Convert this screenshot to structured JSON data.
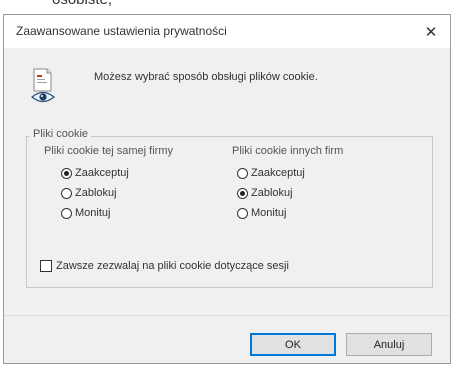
{
  "backdrop": {
    "text": "osobiste;"
  },
  "dialog": {
    "title": "Zaawansowane ustawienia prywatności",
    "close_glyph": "✕",
    "info_text": "Możesz wybrać sposób obsługi plików cookie.",
    "group": {
      "label": "Pliki cookie",
      "first_party": {
        "heading": "Pliki cookie tej samej firmy",
        "options": [
          "Zaakceptuj",
          "Zablokuj",
          "Monituj"
        ],
        "selected": "Zaakceptuj"
      },
      "third_party": {
        "heading": "Pliki cookie innych firm",
        "options": [
          "Zaakceptuj",
          "Zablokuj",
          "Monituj"
        ],
        "selected": "Zablokuj"
      },
      "session_checkbox": {
        "label": "Zawsze zezwalaj na pliki cookie dotyczące sesji",
        "checked": false
      }
    },
    "buttons": {
      "ok": "OK",
      "cancel": "Anuluj"
    }
  },
  "icons": {
    "info": "privacy-document-eye-icon",
    "close": "close-icon"
  }
}
